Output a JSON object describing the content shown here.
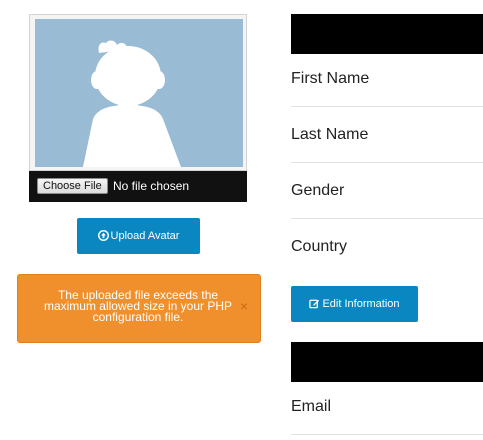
{
  "avatar": {
    "file_input": {
      "button_label": "Choose File",
      "status": "No file chosen"
    },
    "upload_button": {
      "icon": "upload-circle-icon",
      "label": "Upload Avatar"
    }
  },
  "alert": {
    "message": "The uploaded file exceeds the maximum allowed size in your PHP configuration file.",
    "close": "×"
  },
  "profile": {
    "fields": [
      {
        "label": "First Name"
      },
      {
        "label": "Last Name"
      },
      {
        "label": "Gender"
      },
      {
        "label": "Country"
      }
    ],
    "edit_button": {
      "icon": "edit-icon",
      "label": "Edit Information"
    },
    "contact_fields": [
      {
        "label": "Email"
      }
    ]
  },
  "colors": {
    "primary_button": "#0a86c0",
    "alert_background": "#f0902c",
    "avatar_background": "#99bbd4",
    "header_bar": "#000000"
  }
}
